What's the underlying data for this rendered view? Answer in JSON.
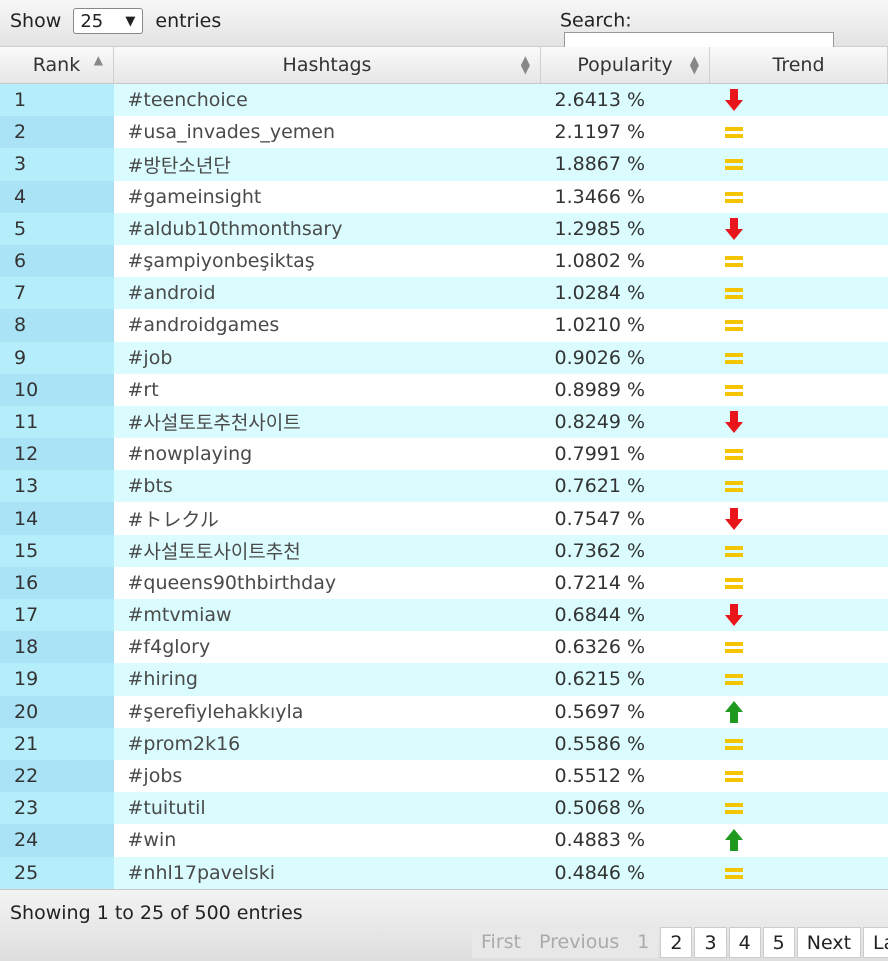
{
  "controls": {
    "show_label": "Show",
    "entries_value": "25",
    "entries_label": "entries",
    "search_label": "Search:"
  },
  "columns": {
    "rank": "Rank",
    "hashtags": "Hashtags",
    "popularity": "Popularity",
    "trend": "Trend"
  },
  "rows": [
    {
      "rank": "1",
      "tag": "#teenchoice",
      "pop": "2.6413 %",
      "trend": "down"
    },
    {
      "rank": "2",
      "tag": "#usa_invades_yemen",
      "pop": "2.1197 %",
      "trend": "same"
    },
    {
      "rank": "3",
      "tag": "#방탄소년단",
      "pop": "1.8867 %",
      "trend": "same"
    },
    {
      "rank": "4",
      "tag": "#gameinsight",
      "pop": "1.3466 %",
      "trend": "same"
    },
    {
      "rank": "5",
      "tag": "#aldub10thmonthsary",
      "pop": "1.2985 %",
      "trend": "down"
    },
    {
      "rank": "6",
      "tag": "#şampiyonbeşiktaş",
      "pop": "1.0802 %",
      "trend": "same"
    },
    {
      "rank": "7",
      "tag": "#android",
      "pop": "1.0284 %",
      "trend": "same"
    },
    {
      "rank": "8",
      "tag": "#androidgames",
      "pop": "1.0210 %",
      "trend": "same"
    },
    {
      "rank": "9",
      "tag": "#job",
      "pop": "0.9026 %",
      "trend": "same"
    },
    {
      "rank": "10",
      "tag": "#rt",
      "pop": "0.8989 %",
      "trend": "same"
    },
    {
      "rank": "11",
      "tag": "#사설토토추천사이트",
      "pop": "0.8249 %",
      "trend": "down"
    },
    {
      "rank": "12",
      "tag": "#nowplaying",
      "pop": "0.7991 %",
      "trend": "same"
    },
    {
      "rank": "13",
      "tag": "#bts",
      "pop": "0.7621 %",
      "trend": "same"
    },
    {
      "rank": "14",
      "tag": "#トレクル",
      "pop": "0.7547 %",
      "trend": "down"
    },
    {
      "rank": "15",
      "tag": "#사설토토사이트추천",
      "pop": "0.7362 %",
      "trend": "same"
    },
    {
      "rank": "16",
      "tag": "#queens90thbirthday",
      "pop": "0.7214 %",
      "trend": "same"
    },
    {
      "rank": "17",
      "tag": "#mtvmiaw",
      "pop": "0.6844 %",
      "trend": "down"
    },
    {
      "rank": "18",
      "tag": "#f4glory",
      "pop": "0.6326 %",
      "trend": "same"
    },
    {
      "rank": "19",
      "tag": "#hiring",
      "pop": "0.6215 %",
      "trend": "same"
    },
    {
      "rank": "20",
      "tag": "#şerefiylehakkıyla",
      "pop": "0.5697 %",
      "trend": "up"
    },
    {
      "rank": "21",
      "tag": "#prom2k16",
      "pop": "0.5586 %",
      "trend": "same"
    },
    {
      "rank": "22",
      "tag": "#jobs",
      "pop": "0.5512 %",
      "trend": "same"
    },
    {
      "rank": "23",
      "tag": "#tuitutil",
      "pop": "0.5068 %",
      "trend": "same"
    },
    {
      "rank": "24",
      "tag": "#win",
      "pop": "0.4883 %",
      "trend": "up"
    },
    {
      "rank": "25",
      "tag": "#nhl17pavelski",
      "pop": "0.4846 %",
      "trend": "same"
    }
  ],
  "footer": {
    "info": "Showing 1 to 25 of 500 entries",
    "first": "First",
    "previous": "Previous",
    "pages": [
      "1",
      "2",
      "3",
      "4",
      "5"
    ],
    "next": "Next",
    "last": "Last"
  },
  "colors": {
    "down": "#e8161b",
    "same": "#f5c400",
    "up": "#1f9a1f"
  }
}
